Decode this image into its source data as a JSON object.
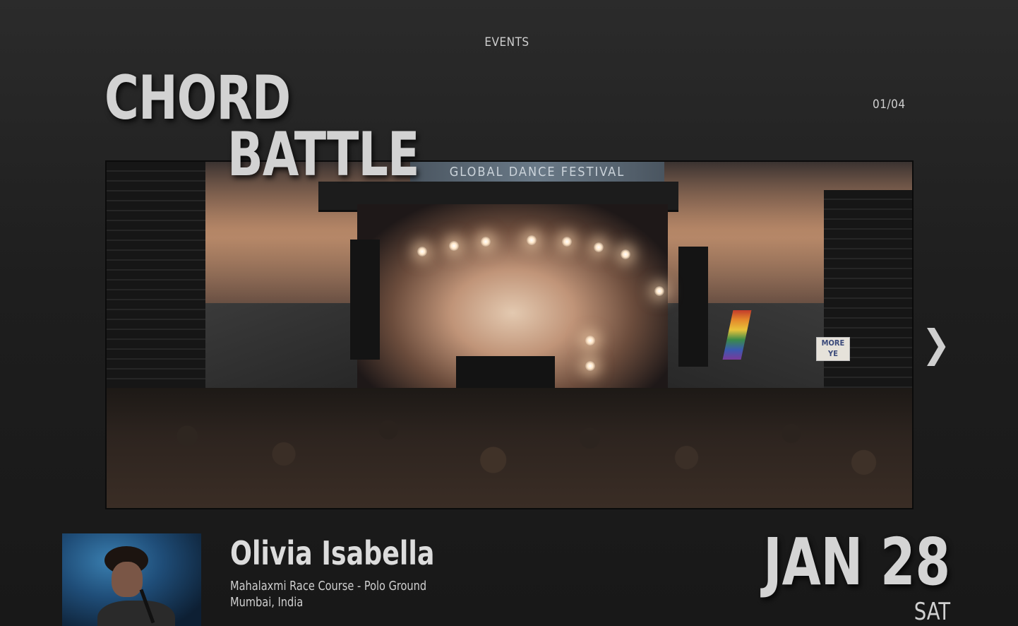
{
  "header": {
    "section_label": "EVENTS",
    "counter": "01/04"
  },
  "event": {
    "title_line1": "CHORD",
    "title_line2": "BATTLE",
    "banner_text": "GLOBAL DANCE FESTIVAL",
    "crowd_sign_text": "MORE YE",
    "artist_name": "Olivia Isabella",
    "venue_line1": "Mahalaxmi Race Course - Polo Ground",
    "venue_line2": "Mumbai, India",
    "date": "JAN 28",
    "day": "SAT"
  },
  "controls": {
    "next_arrow": "❯",
    "next_icon": "chevron-right-icon"
  },
  "colors": {
    "background": "#1e1e1e",
    "text": "#d2d2d2"
  }
}
